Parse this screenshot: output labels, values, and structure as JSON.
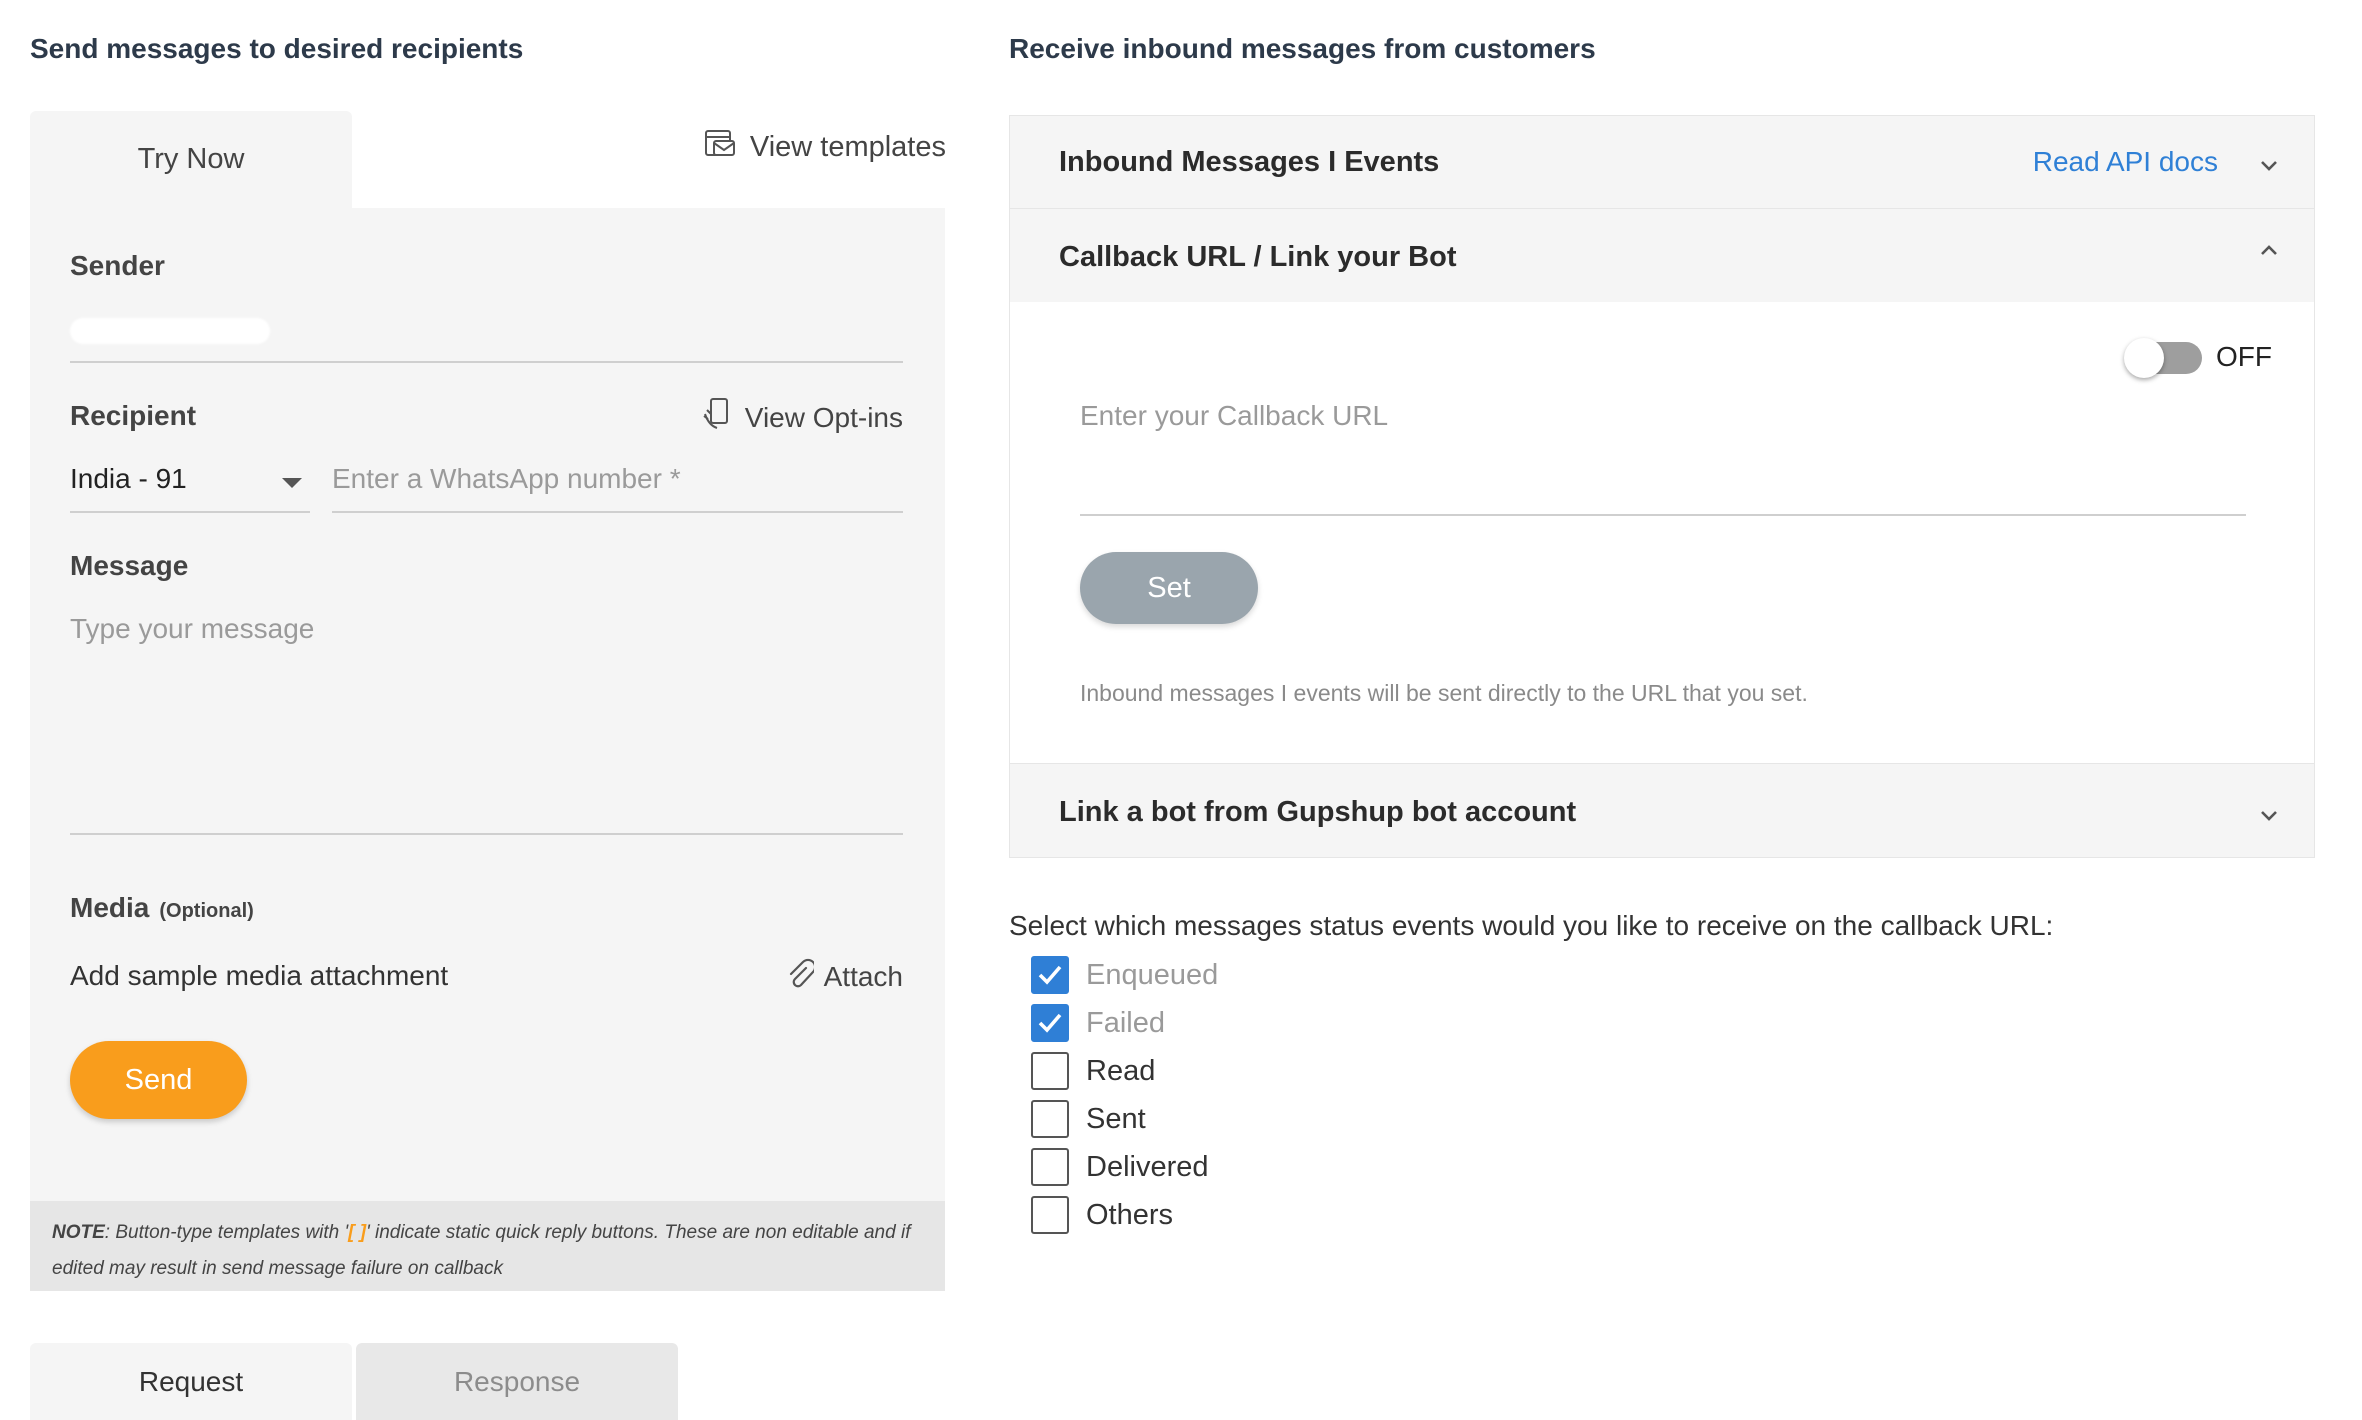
{
  "left": {
    "heading": "Send messages to desired recipients",
    "tab_try_now": "Try Now",
    "view_templates": "View templates",
    "sender_label": "Sender",
    "recipient_label": "Recipient",
    "view_optins": "View Opt-ins",
    "country_code": "India - 91",
    "number_placeholder": "Enter a WhatsApp number *",
    "message_label": "Message",
    "message_placeholder": "Type your message",
    "media_label": "Media",
    "media_optional": "(Optional)",
    "media_prompt": "Add sample media attachment",
    "attach": "Attach",
    "send": "Send",
    "note_prefix": "NOTE",
    "note_text_1": ": Button-type templates with '",
    "note_brackets": "[ ]",
    "note_text_2": "' indicate static quick reply buttons. These are non editable and if edited may result in send message failure on callback",
    "tab_request": "Request",
    "tab_response": "Response"
  },
  "right": {
    "heading": "Receive inbound messages from customers",
    "inbound_title": "Inbound Messages I Events",
    "read_api_docs": "Read API docs",
    "callback_title": "Callback URL / Link your Bot",
    "toggle_state": "OFF",
    "callback_placeholder": "Enter your Callback URL",
    "set": "Set",
    "helper": "Inbound messages I events will be sent directly to the URL that you set.",
    "bot_title": "Link a bot from Gupshup bot account",
    "status_question": "Select which messages status events would you like to receive on the callback URL:",
    "statuses": [
      {
        "label": "Enqueued",
        "checked": true
      },
      {
        "label": "Failed",
        "checked": true
      },
      {
        "label": "Read",
        "checked": false
      },
      {
        "label": "Sent",
        "checked": false
      },
      {
        "label": "Delivered",
        "checked": false
      },
      {
        "label": "Others",
        "checked": false
      }
    ]
  },
  "colors": {
    "accent_orange": "#f99d1c",
    "link_blue": "#2f80d6",
    "checkbox_blue": "#2f7fd6"
  }
}
